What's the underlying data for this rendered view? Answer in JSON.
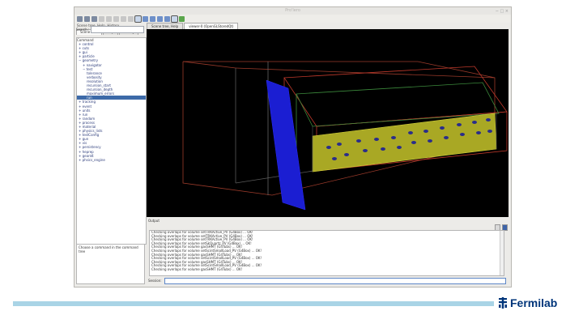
{
  "window": {
    "title": "Pro'lero",
    "controls": "− □ ×"
  },
  "left_panel": {
    "header": "Scene tree, Help, History",
    "tabs": [
      "Scene tree",
      "Help",
      "History"
    ],
    "search_label": "Search :",
    "tree_header": "Command",
    "tree_items": [
      {
        "label": "+ control",
        "depth": 0
      },
      {
        "label": "+ cuts",
        "depth": 0
      },
      {
        "label": "+ gui",
        "depth": 0
      },
      {
        "label": "+ particle",
        "depth": 0
      },
      {
        "label": "− geometry",
        "depth": 0
      },
      {
        "label": "+ navigator",
        "depth": 1
      },
      {
        "label": "− test",
        "depth": 1
      },
      {
        "label": "tolerance",
        "depth": 2
      },
      {
        "label": "verbosity",
        "depth": 2
      },
      {
        "label": "resolution",
        "depth": 2
      },
      {
        "label": "recursion_start",
        "depth": 2
      },
      {
        "label": "recursion_depth",
        "depth": 2
      },
      {
        "label": "maximum_errors",
        "depth": 2
      },
      {
        "label": "run",
        "depth": 2,
        "selected": true
      },
      {
        "label": "+ tracking",
        "depth": 0
      },
      {
        "label": "+ event",
        "depth": 0
      },
      {
        "label": "+ units",
        "depth": 0
      },
      {
        "label": "+ run",
        "depth": 0
      },
      {
        "label": "+ random",
        "depth": 0
      },
      {
        "label": "+ process",
        "depth": 0
      },
      {
        "label": "+ material",
        "depth": 0
      },
      {
        "label": "+ physics_lists",
        "depth": 0
      },
      {
        "label": "+ testConfig",
        "depth": 0
      },
      {
        "label": "+ gun",
        "depth": 0
      },
      {
        "label": "+ vis",
        "depth": 0
      },
      {
        "label": "+ persistency",
        "depth": 0
      },
      {
        "label": "+ heprep",
        "depth": 0
      },
      {
        "label": "+ geant4",
        "depth": 0
      },
      {
        "label": "+ phsics_engine",
        "depth": 0
      }
    ],
    "help_text": "Choose a command in the command tree"
  },
  "viewer_tabs": [
    "Scene tree, Help",
    "viewer-0 (OpenGLStoredQt)"
  ],
  "output": {
    "label": "Output",
    "lines": [
      "Checking overlaps for volume setTRKActive_PV (G4Box) ... OK!",
      "Checking overlaps for volume setTRKActive_PV (G4Box) ... OK!",
      "Checking overlaps for volume setTRKActive_PV (G4Box) ... OK!",
      "Checking overlaps for volume setSkQuartz_PV (G4Box) ... OK!",
      "Checking overlaps for volume gasSHMT (G4Tubs) ... OK!",
      "Checking overlaps for volume setScintSmallLoad_PV (G4Box) ... OK!",
      "Checking overlaps for volume gasSHMT (G4Tubs) ... OK!",
      "Checking overlaps for volume setScintSmallLoad_PV (G4Box) ... OK!",
      "Checking overlaps for volume gasSHMT (G4Tubs) ... OK!",
      "Checking overlaps for volume setScintSmallLoad_PV (G4Box) ... OK!",
      "Checking overlaps for volume gasSHMT (G4Tubs) ... OK!"
    ]
  },
  "session": {
    "label": "Session:"
  },
  "footer": {
    "logo_text": "Fermilab"
  },
  "colors": {
    "viewer_bg": "#000000",
    "detector_face": "#a9a824",
    "blue_plane": "#1b1ed2",
    "wire_red": "#c0392b",
    "footer_bar": "#a9d4e6",
    "logo": "#00357a"
  }
}
